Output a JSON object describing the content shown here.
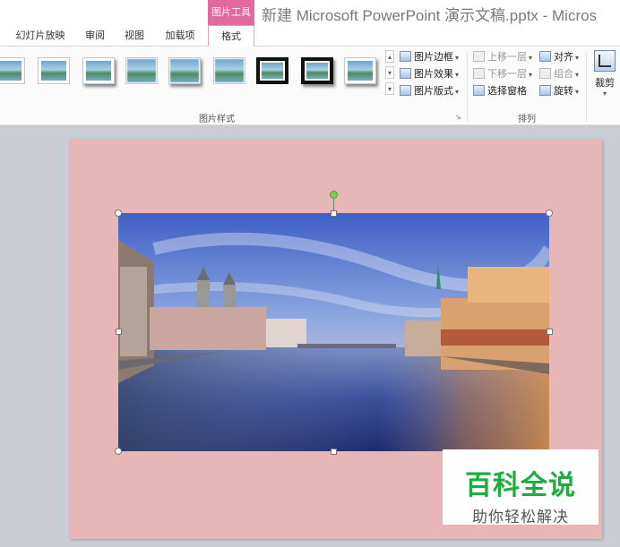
{
  "title_bar": {
    "context_tab": "图片工具",
    "document_title": "新建 Microsoft PowerPoint 演示文稿.pptx - Micros"
  },
  "tabs": [
    {
      "label": "幻灯片放映"
    },
    {
      "label": "审阅"
    },
    {
      "label": "视图"
    },
    {
      "label": "加载项"
    },
    {
      "label": "格式",
      "active": true
    }
  ],
  "ribbon": {
    "picture_styles_label": "图片样式",
    "picture_border": "图片边框",
    "picture_effects": "图片效果",
    "picture_layout": "图片版式",
    "arrange_label": "排列",
    "bring_forward": "上移一层",
    "send_backward": "下移一层",
    "selection_pane": "选择窗格",
    "align": "对齐",
    "group": "组合",
    "rotate": "旋转",
    "crop": "裁剪"
  },
  "watermark": {
    "main": "百科全说",
    "sub": "助你轻松解决"
  },
  "colors": {
    "context_accent": "#e2699b",
    "slide_background": "#e6b7b6",
    "watermark_green": "#1ead3c"
  }
}
